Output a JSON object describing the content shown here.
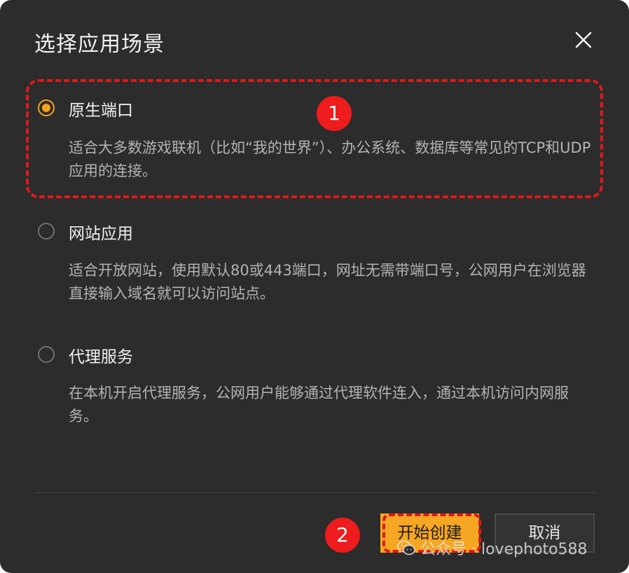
{
  "dialog": {
    "title": "选择应用场景",
    "close_icon": "close-icon"
  },
  "options": [
    {
      "label": "原生端口",
      "description": "适合大多数游戏联机（比如“我的世界”）、办公系统、数据库等常见的TCP和UDP应用的连接。",
      "selected": true
    },
    {
      "label": "网站应用",
      "description": "适合开放网站，使用默认80或443端口，网址无需带端口号，公网用户在浏览器直接输入域名就可以访问站点。",
      "selected": false
    },
    {
      "label": "代理服务",
      "description": "在本机开启代理服务，公网用户能够通过代理软件连入，通过本机访问内网服务。",
      "selected": false
    }
  ],
  "annotations": {
    "badge_1": "1",
    "badge_2": "2",
    "color": "#ee1c1c"
  },
  "footer": {
    "create_label": "开始创建",
    "cancel_label": "取消"
  },
  "watermark": {
    "icon": "wechat-icon",
    "text": "公众号 · lovephoto588"
  },
  "colors": {
    "accent": "#f5a623",
    "background": "#2c2c2c"
  }
}
